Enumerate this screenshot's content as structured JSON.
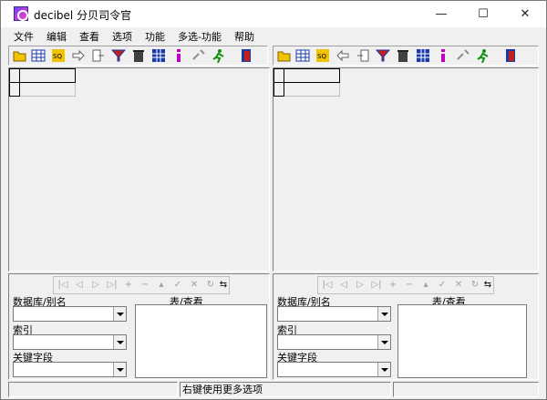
{
  "window": {
    "title": "decibel 分贝司令官",
    "minimize_glyph": "—",
    "maximize_glyph": "☐",
    "close_glyph": "✕"
  },
  "menu": [
    "文件",
    "编辑",
    "查看",
    "选项",
    "功能",
    "多选-功能",
    "帮助"
  ],
  "toolbar_icons": [
    "open-folder-icon",
    "table-icon",
    "sql-icon",
    "arrow-right-icon",
    "copy-right-icon",
    "filter-icon",
    "trash-icon",
    "grid-icon",
    "info-icon",
    "tools-icon",
    "run-icon",
    "exit-icon"
  ],
  "left": {
    "labels": {
      "db": "数据库/别名",
      "index": "索引",
      "key": "关键字段",
      "table": "表/查看"
    }
  },
  "right": {
    "labels": {
      "db": "数据库/别名",
      "index": "索引",
      "key": "关键字段",
      "table": "表/查看"
    }
  },
  "status": {
    "hint": "右键使用更多选项"
  },
  "colors": {
    "icon_yellow": "#f2c400",
    "icon_blue": "#1a3aa8",
    "icon_green": "#109010",
    "icon_magenta": "#c000c0",
    "icon_red": "#c02020"
  }
}
